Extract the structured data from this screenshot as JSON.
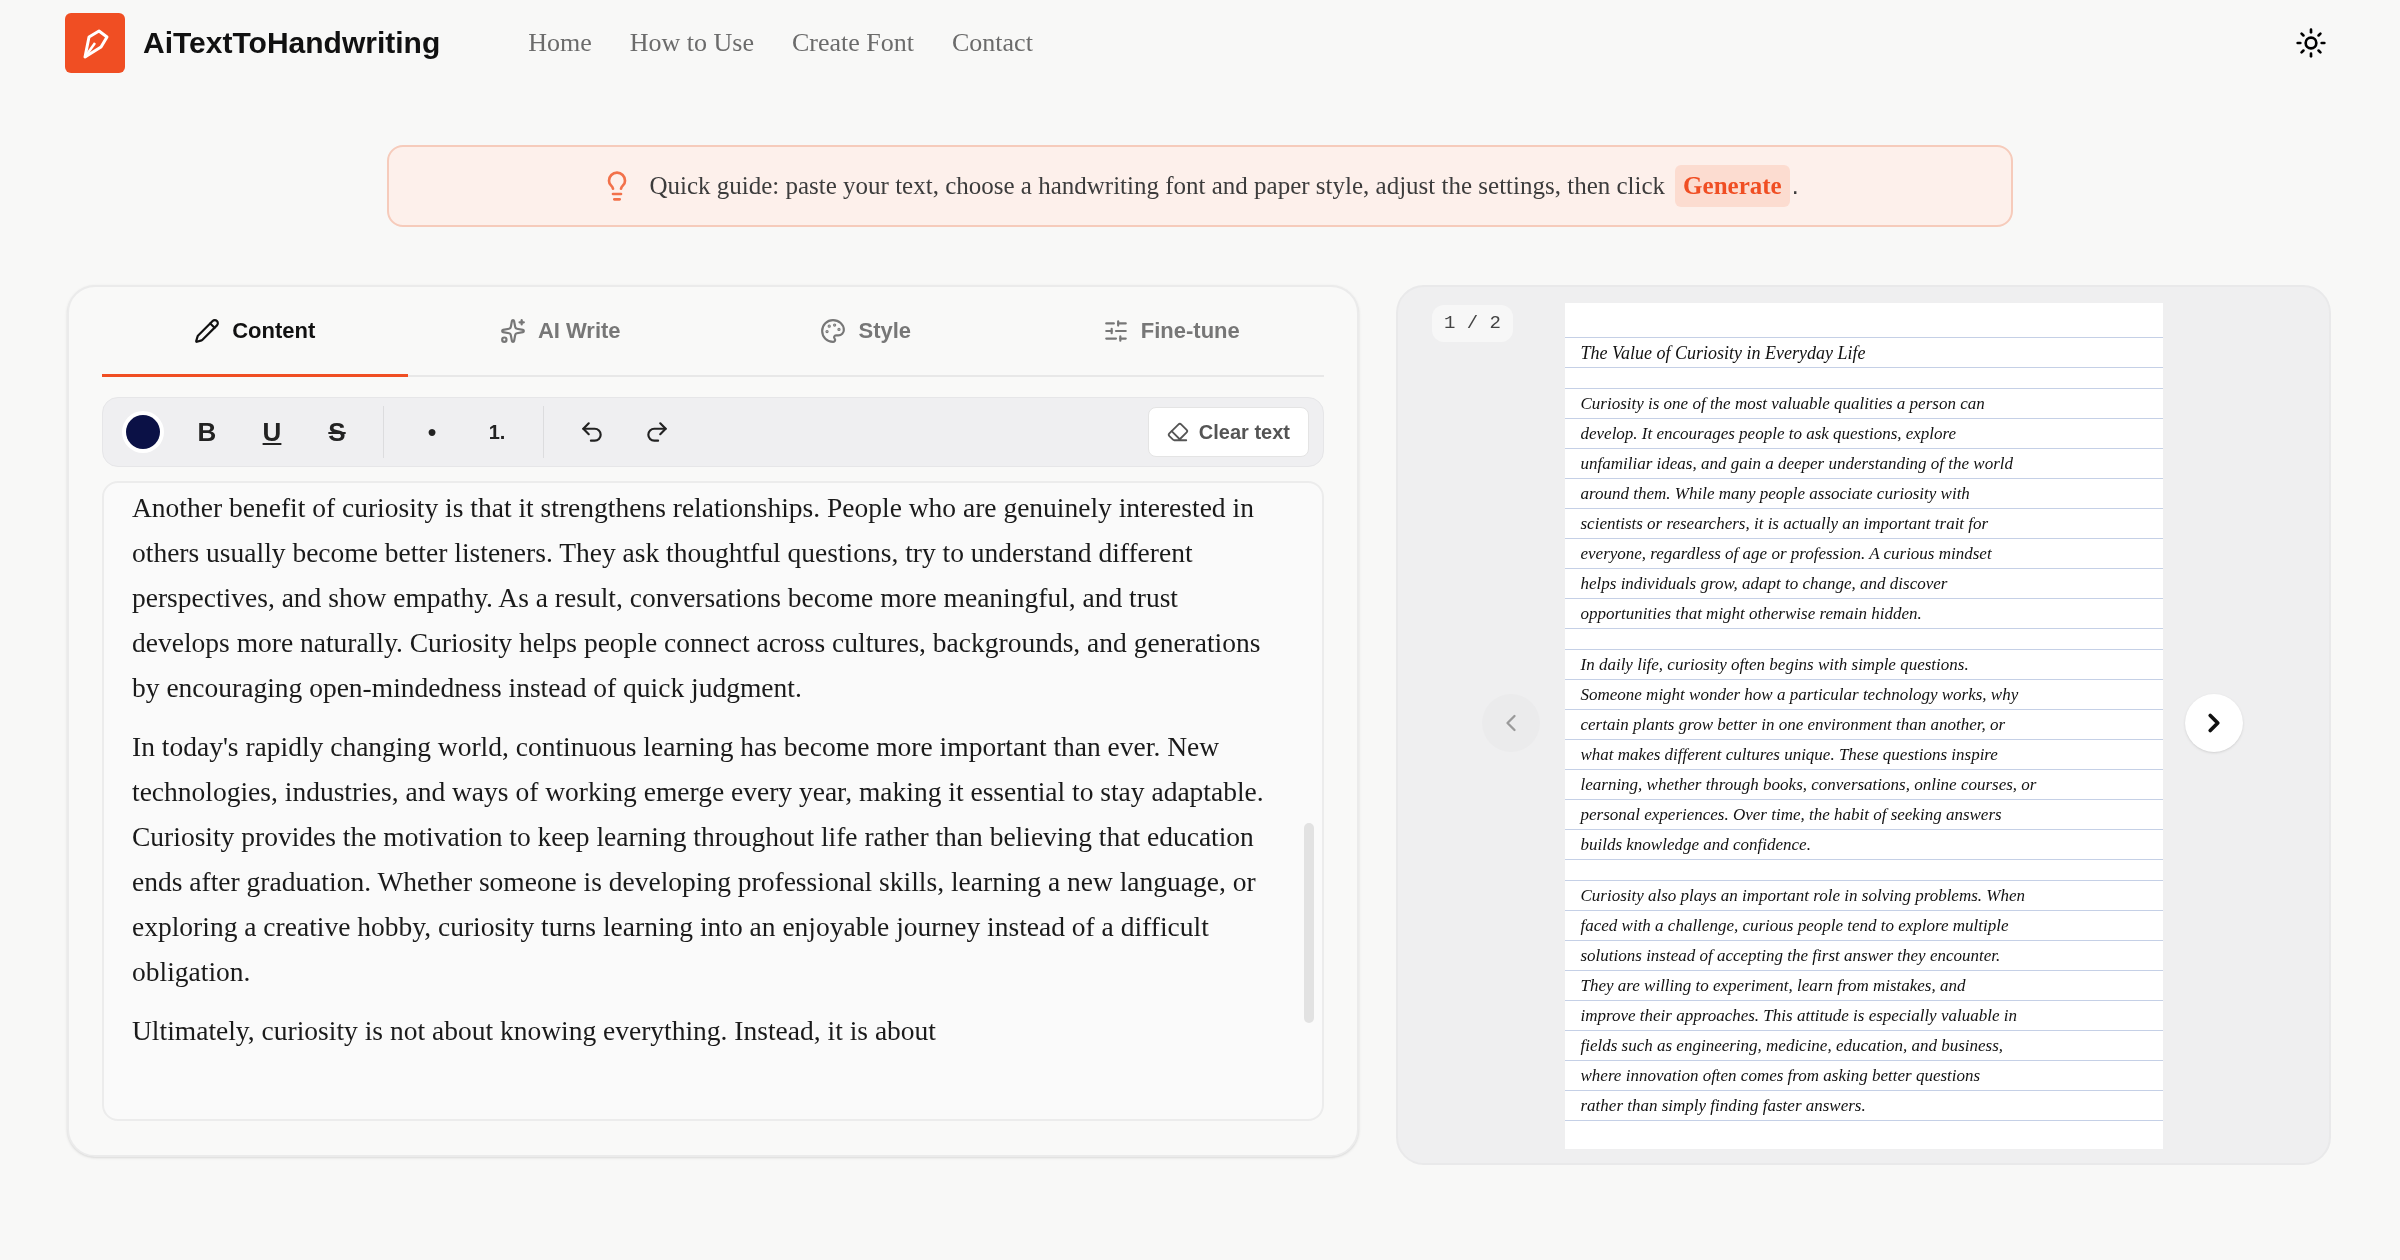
{
  "header": {
    "brand": "AiTextToHandwriting",
    "nav": [
      {
        "label": "Home"
      },
      {
        "label": "How to Use"
      },
      {
        "label": "Create Font"
      },
      {
        "label": "Contact"
      }
    ]
  },
  "guide": {
    "text": "Quick guide: paste your text, choose a handwriting font and paper style, adjust the settings, then click",
    "action": "Generate",
    "after": "."
  },
  "editor": {
    "tabs": [
      {
        "kind": "pencil",
        "label": "Content",
        "selected": true
      },
      {
        "kind": "sparkles",
        "label": "AI Write",
        "selected": false
      },
      {
        "kind": "palette",
        "label": "Style",
        "selected": false
      },
      {
        "kind": "sliders",
        "label": "Fine-tune",
        "selected": false
      }
    ],
    "toolbar": {
      "color": "#0b1146",
      "groups": [
        [
          {
            "kind": "bold",
            "label": "B"
          },
          {
            "kind": "underline",
            "label": "U"
          },
          {
            "kind": "strike",
            "label": "S"
          }
        ],
        [
          {
            "kind": "bullet",
            "label": "●"
          },
          {
            "kind": "numbered",
            "label": "1."
          }
        ],
        [
          {
            "kind": "undo"
          },
          {
            "kind": "redo"
          }
        ]
      ],
      "clear": "Clear text"
    },
    "paragraphs": [
      "Another benefit of curiosity is that it strengthens relationships. People who are genuinely interested in others usually become better listeners. They ask thoughtful questions, try to understand different perspectives, and show empathy. As a result, conversations become more meaningful, and trust develops more naturally. Curiosity helps people connect across cultures, backgrounds, and generations by encouraging open-mindedness instead of quick judgment.",
      "In today's rapidly changing world, continuous learning has become more important than ever. New technologies, industries, and ways of working emerge every year, making it essential to stay adaptable. Curiosity provides the motivation to keep learning throughout life rather than believing that education ends after graduation. Whether someone is developing professional skills, learning a new language, or exploring a creative hobby, curiosity turns learning into an enjoyable journey instead of a difficult obligation.",
      "Ultimately, curiosity is not about knowing everything. Instead, it is about"
    ]
  },
  "preview": {
    "page_counter": "1 / 2",
    "prev": {
      "disabled": true
    },
    "next": {
      "disabled": false
    },
    "title": "The Value of Curiosity in Everyday Life",
    "paragraphs": [
      [
        "Curiosity is one of the most valuable qualities a person can",
        "develop. It encourages people to ask questions, explore",
        "unfamiliar ideas, and gain a deeper understanding of the world",
        "around them. While many people associate curiosity with",
        "scientists or researchers, it is actually an important trait for",
        "everyone, regardless of age or profession. A curious mindset",
        "helps individuals grow, adapt to change, and discover",
        "opportunities that might otherwise remain hidden."
      ],
      [
        "In daily life, curiosity often begins with simple questions.",
        "Someone might wonder how a particular technology works, why",
        "certain plants grow better in one environment than another, or",
        "what makes different cultures unique. These questions inspire",
        "learning, whether through books, conversations, online courses, or",
        "personal experiences. Over time, the habit of seeking answers",
        "builds knowledge and confidence."
      ],
      [
        "Curiosity also plays an important role in solving problems. When",
        "faced with a challenge, curious people tend to explore multiple",
        "solutions instead of accepting the first answer they encounter.",
        "They are willing to experiment, learn from mistakes, and",
        "improve their approaches. This attitude is especially valuable in",
        "fields such as engineering, medicine, education, and business,",
        "where innovation often comes from asking better questions",
        "rather than simply finding faster answers."
      ]
    ]
  }
}
